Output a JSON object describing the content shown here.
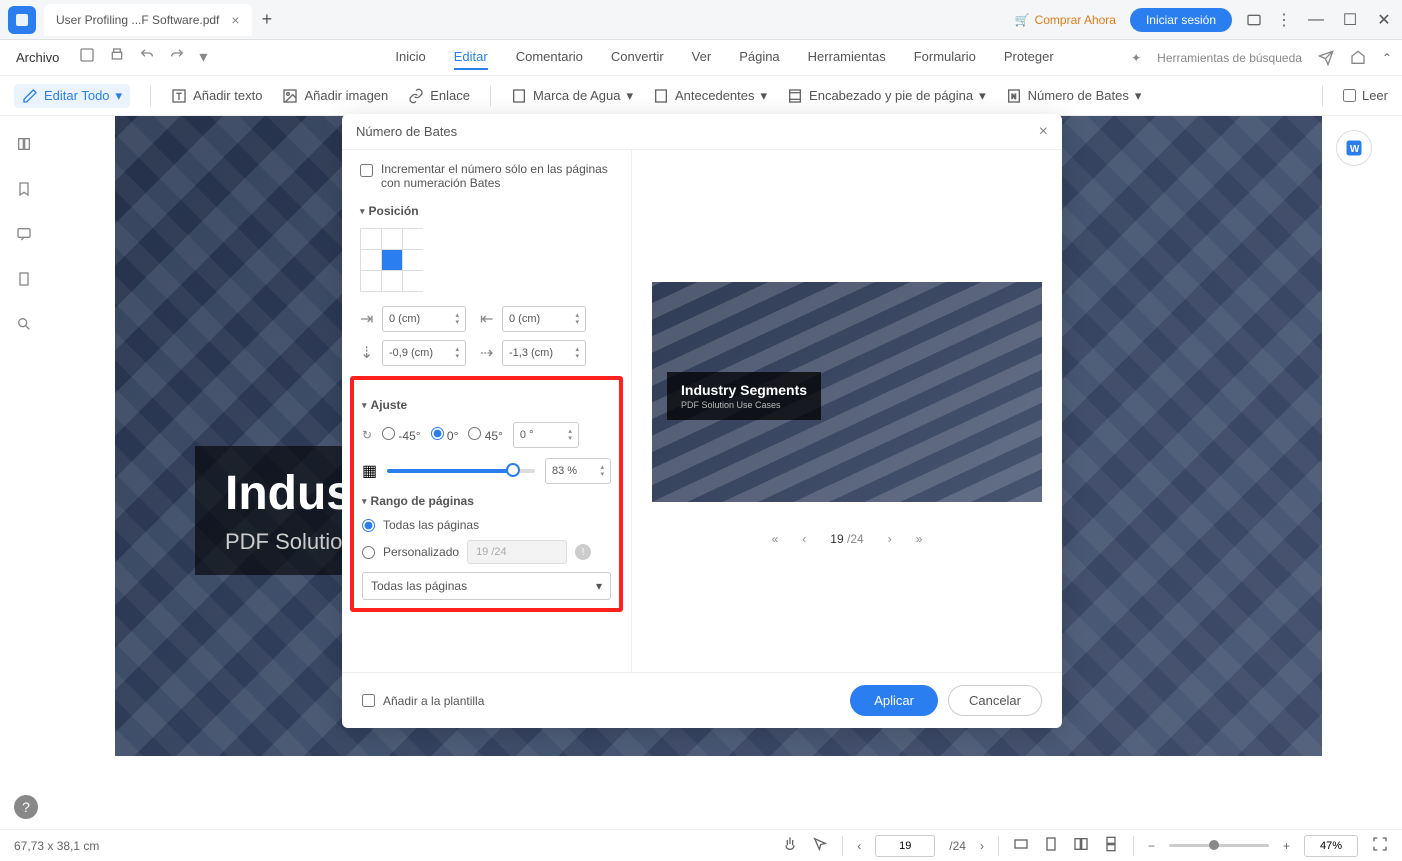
{
  "titlebar": {
    "tab_name": "User Profiling ...F Software.pdf",
    "buy_now": "Comprar Ahora",
    "login": "Iniciar sesión"
  },
  "menubar": {
    "file": "Archivo",
    "tabs": [
      "Inicio",
      "Editar",
      "Comentario",
      "Convertir",
      "Ver",
      "Página",
      "Herramientas",
      "Formulario",
      "Proteger"
    ],
    "active_index": 1,
    "search_tools": "Herramientas de búsqueda"
  },
  "toolbar": {
    "edit_all": "Editar Todo",
    "add_text": "Añadir texto",
    "add_image": "Añadir imagen",
    "link": "Enlace",
    "watermark": "Marca de Agua",
    "background": "Antecedentes",
    "header_footer": "Encabezado y pie de página",
    "bates": "Número de Bates",
    "read": "Leer"
  },
  "document": {
    "title": "Industry",
    "subtitle": "PDF Solution"
  },
  "dialog": {
    "title": "Número de Bates",
    "increment_only": "Incrementar el número sólo en las páginas con numeración Bates",
    "position_section": "Posición",
    "margin_top": "0 (cm)",
    "margin_left": "0 (cm)",
    "margin_bottom": "-0,9 (cm)",
    "margin_right": "-1,3 (cm)",
    "adjust_section": "Ajuste",
    "angle_neg45": "-45°",
    "angle_0": "0°",
    "angle_45": "45°",
    "angle_value": "0 °",
    "opacity_value": "83 %",
    "range_section": "Rango de páginas",
    "all_pages": "Todas las páginas",
    "custom": "Personalizado",
    "custom_placeholder": "19 /24",
    "range_dropdown": "Todas las páginas",
    "preview": {
      "title": "Industry Segments",
      "subtitle": "PDF Solution Use Cases",
      "current_page": "19",
      "total_pages": "/24"
    },
    "add_template": "Añadir a la plantilla",
    "apply": "Aplicar",
    "cancel": "Cancelar"
  },
  "statusbar": {
    "dimensions": "67,73 x 38,1 cm",
    "page_input": "19",
    "page_total": "/24",
    "zoom": "47%"
  }
}
